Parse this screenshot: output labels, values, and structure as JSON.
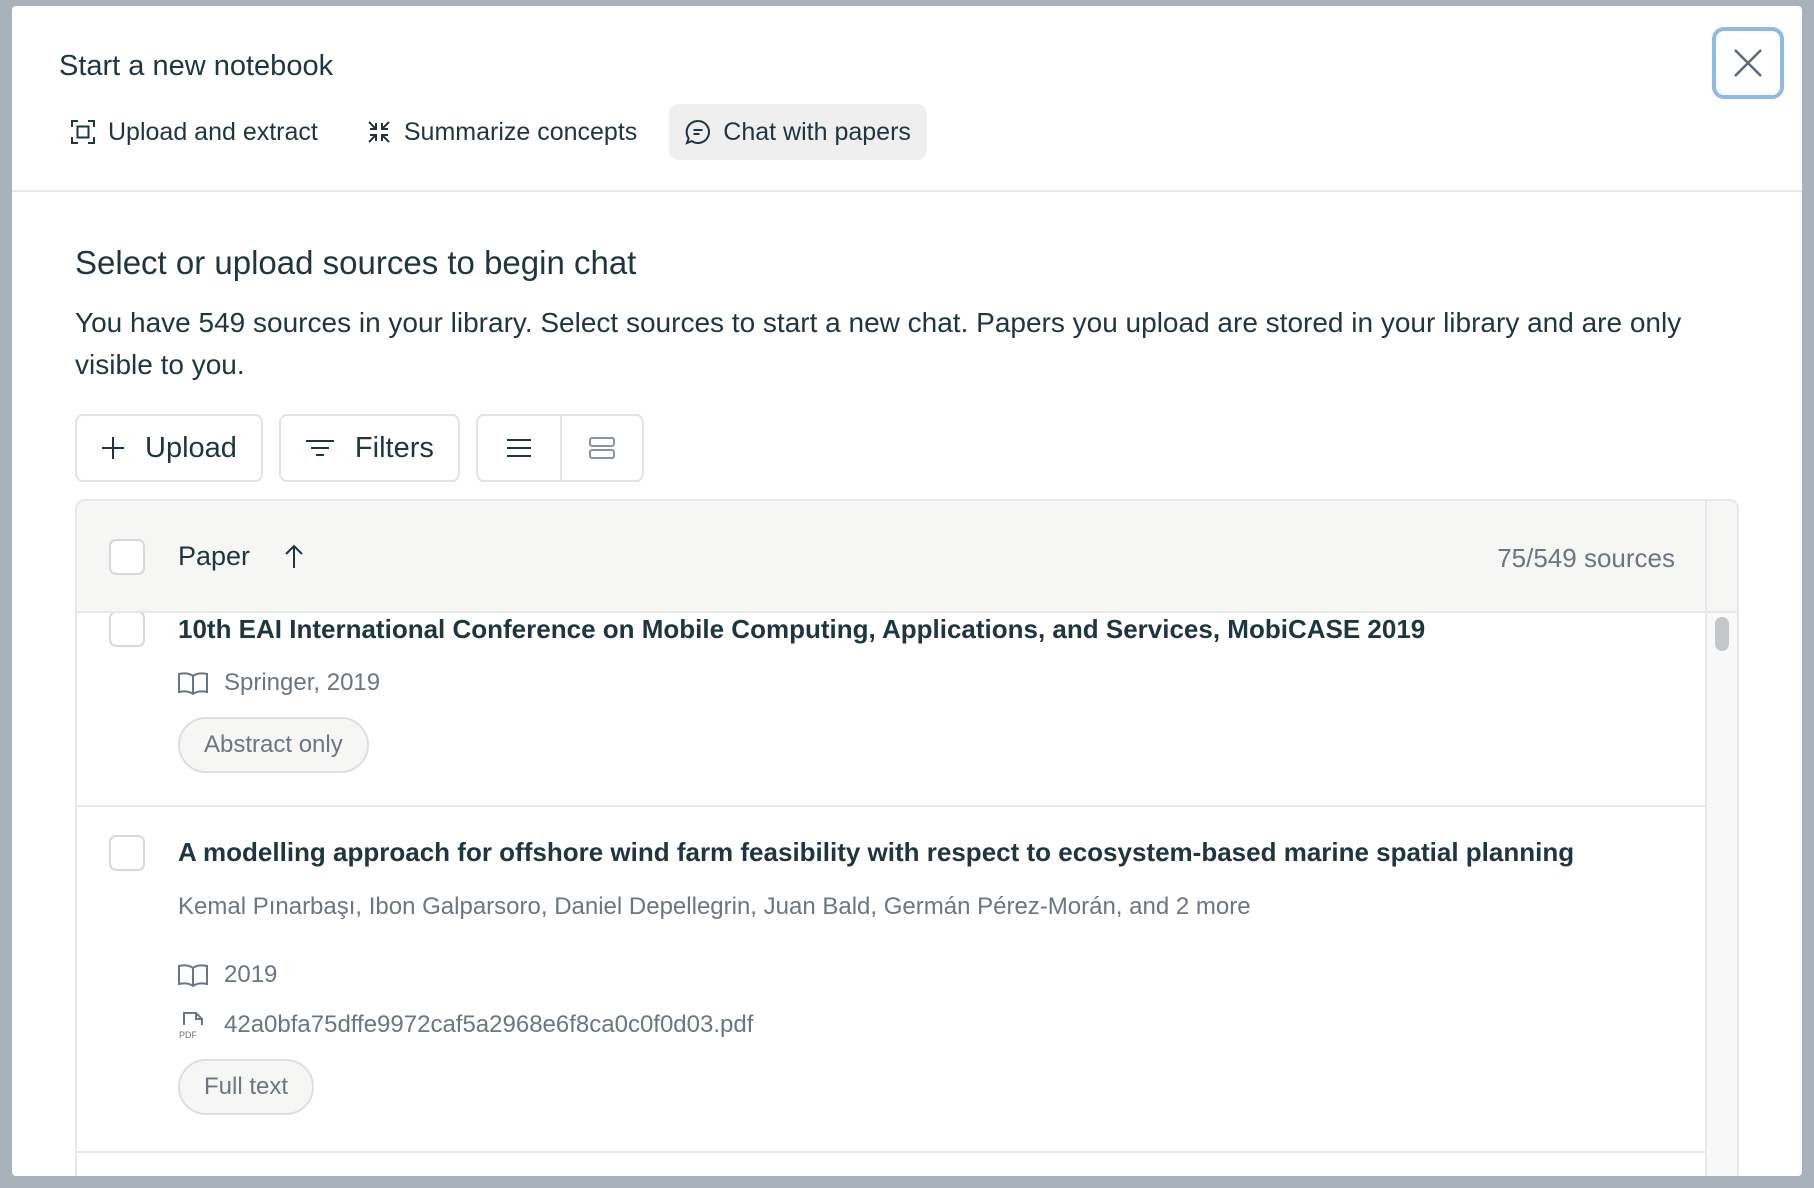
{
  "header": {
    "title": "Start a new notebook",
    "tabs": [
      {
        "label": "Upload and extract",
        "icon": "scan-icon"
      },
      {
        "label": "Summarize concepts",
        "icon": "collapse-icon"
      },
      {
        "label": "Chat with papers",
        "icon": "chat-bubble-icon",
        "active": true
      }
    ]
  },
  "main": {
    "title": "Select or upload sources to begin chat",
    "description": "You have 549 sources in your library. Select sources to start a new chat. Papers you upload are stored in your library and are only visible to you.",
    "toolbar": {
      "upload_label": "Upload",
      "filters_label": "Filters"
    },
    "table": {
      "column_paper": "Paper",
      "sources_count": "75/549 sources",
      "rows": [
        {
          "title": "10th EAI International Conference on Mobile Computing, Applications, and Services, MobiCASE 2019",
          "venue": "Springer, 2019",
          "badge": "Abstract only"
        },
        {
          "title": "A modelling approach for offshore wind farm feasibility with respect to ecosystem-based marine spatial planning",
          "authors": "Kemal Pınarbaşı, Ibon Galparsoro, Daniel Depellegrin, Juan Bald, Germán Pérez-Morán, and 2 more",
          "venue": "2019",
          "file": "42a0bfa75dffe9972caf5a2968e6f8ca0c0f0d03.pdf",
          "file_icon_label": "PDF",
          "badge": "Full text"
        }
      ]
    }
  },
  "colors": {
    "text": "#1f3540",
    "muted": "#6b7680",
    "close_focus_ring": "#8ebbe3",
    "active_tab_bg": "#efefef"
  }
}
